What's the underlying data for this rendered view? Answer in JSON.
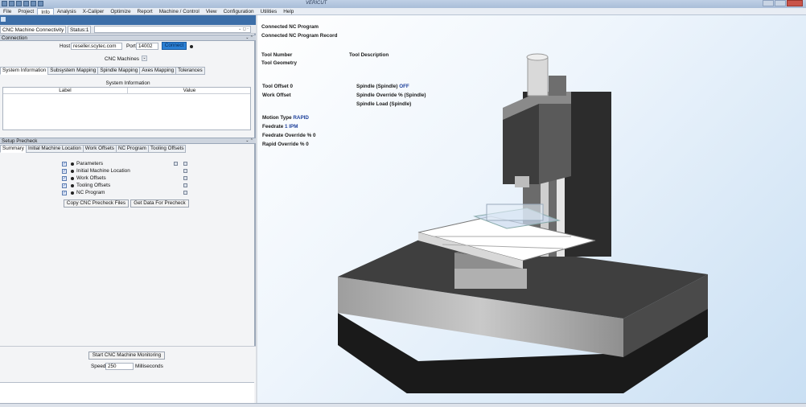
{
  "app": {
    "title": "VERICUT"
  },
  "menu": [
    "File",
    "Project",
    "Info",
    "Analysis",
    "X-Caliper",
    "Optimize",
    "Report",
    "Machine / Control",
    "View",
    "Configuration",
    "Utilities",
    "Help"
  ],
  "menu_active": "Info",
  "panel": {
    "tab_label": "CNC Machine Connectivity",
    "status_label": "Status:1",
    "connection_header": "Connection",
    "host_label": "Host",
    "host_value": "reseller.scytec.com",
    "port_label": "Port",
    "port_value": "14002",
    "connect_button": "Connect",
    "cnc_machines_label": "CNC Machines",
    "info_tabs": [
      "System Information",
      "Subsystem Mapping",
      "Spindle Mapping",
      "Axes Mapping",
      "Tolerances"
    ],
    "system_info_title": "System Information",
    "table_headers": [
      "Label",
      "Value"
    ],
    "setup_header": "Setup Precheck",
    "precheck_tabs": [
      "Summary",
      "Initial Machine Location",
      "Work Offsets",
      "NC Program",
      "Tooling Offsets"
    ],
    "precheck_items": [
      "Parameters",
      "Initial Machine Location",
      "Work Offsets",
      "Tooling Offsets",
      "NC Program"
    ],
    "copy_button": "Copy CNC Precheck Files",
    "get_data_button": "Get Data For Precheck",
    "start_button": "Start CNC Machine Monitoring",
    "speed_label": "Speed",
    "speed_value": "250",
    "speed_unit": "Milliseconds"
  },
  "viewport": {
    "connected_program": "Connected NC Program",
    "connected_record": "Connected NC Program Record",
    "tool_number": "Tool Number",
    "tool_description": "Tool Description",
    "tool_geometry": "Tool Geometry",
    "tool_offset": "Tool Offset 0",
    "work_offset": "Work Offset",
    "spindle_label": "Spindle (Spindle)",
    "spindle_value": "OFF",
    "spindle_override": "Spindle Override % (Spindle)",
    "spindle_load": "Spindle Load (Spindle)",
    "motion_type_label": "Motion Type",
    "motion_type_value": "RAPID",
    "feedrate_label": "Feedrate",
    "feedrate_value": "1 IPM",
    "feedrate_override": "Feedrate Override % 0",
    "rapid_override": "Rapid Override % 0"
  }
}
